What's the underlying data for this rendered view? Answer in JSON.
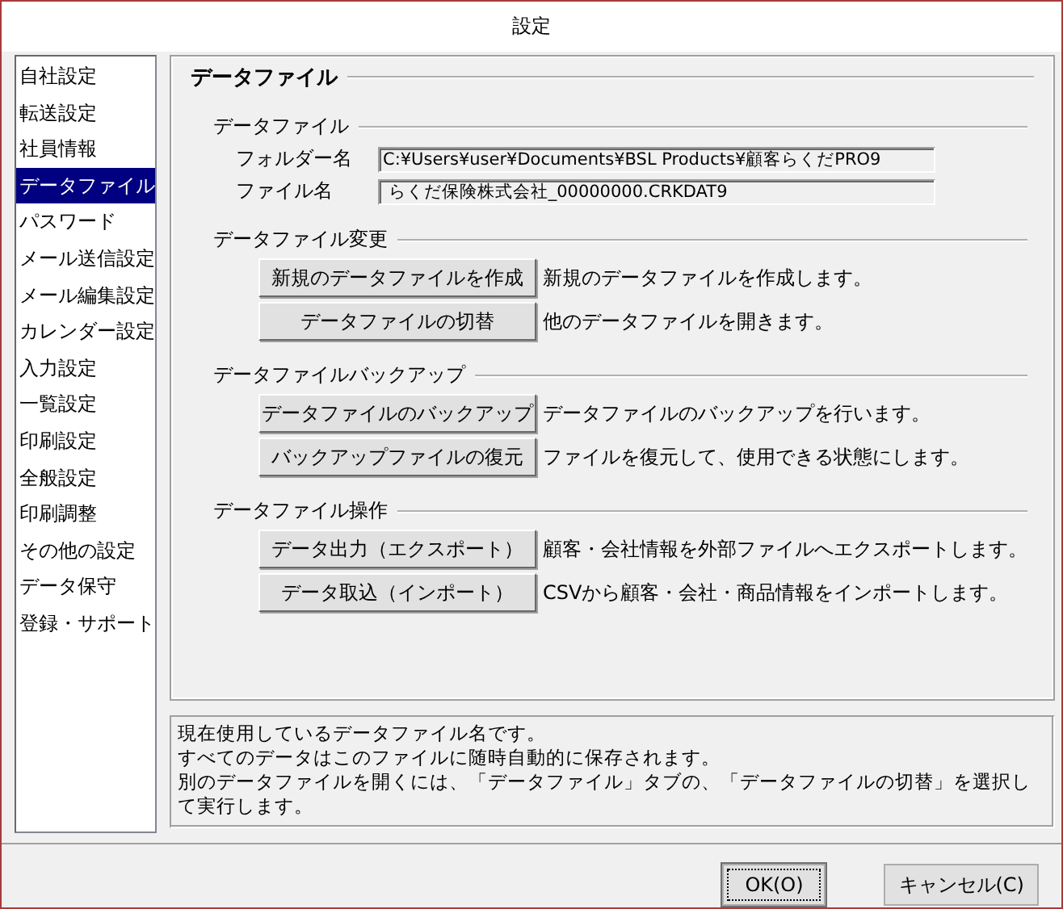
{
  "window": {
    "title": "設定"
  },
  "sidebar": {
    "items": [
      {
        "label": "自社設定",
        "selected": false
      },
      {
        "label": "転送設定",
        "selected": false
      },
      {
        "label": "社員情報",
        "selected": false
      },
      {
        "label": "データファイル",
        "selected": true
      },
      {
        "label": "パスワード",
        "selected": false
      },
      {
        "label": "メール送信設定",
        "selected": false
      },
      {
        "label": "メール編集設定",
        "selected": false
      },
      {
        "label": "カレンダー設定",
        "selected": false
      },
      {
        "label": "入力設定",
        "selected": false
      },
      {
        "label": "一覧設定",
        "selected": false
      },
      {
        "label": "印刷設定",
        "selected": false
      },
      {
        "label": "全般設定",
        "selected": false
      },
      {
        "label": "印刷調整",
        "selected": false
      },
      {
        "label": "その他の設定",
        "selected": false
      },
      {
        "label": "データ保守",
        "selected": false
      },
      {
        "label": "登録・サポート",
        "selected": false
      }
    ]
  },
  "panel": {
    "title": "データファイル",
    "sections": [
      {
        "title": "データファイル",
        "kind": "fields",
        "fields": [
          {
            "label": "フォルダー名",
            "value": "C:¥Users¥user¥Documents¥BSL Products¥顧客らくだPRO9"
          },
          {
            "label": "ファイル名",
            "value": " らくだ保険株式会社_00000000.CRKDAT9"
          }
        ]
      },
      {
        "title": "データファイル変更",
        "kind": "actions",
        "actions": [
          {
            "button": "新規のデータファイルを作成",
            "description": "新規のデータファイルを作成します。"
          },
          {
            "button": "データファイルの切替",
            "description": "他のデータファイルを開きます。"
          }
        ]
      },
      {
        "title": "データファイルバックアップ",
        "kind": "actions",
        "actions": [
          {
            "button": "データファイルのバックアップ",
            "description": "データファイルのバックアップを行います。"
          },
          {
            "button": "バックアップファイルの復元",
            "description": "ファイルを復元して、使用できる状態にします。"
          }
        ]
      },
      {
        "title": "データファイル操作",
        "kind": "actions",
        "actions": [
          {
            "button": "データ出力（エクスポート）",
            "description": "顧客・会社情報を外部ファイルへエクスポートします。"
          },
          {
            "button": "データ取込（インポート）",
            "description": "CSVから顧客・会社・商品情報をインポートします。"
          }
        ]
      }
    ]
  },
  "help_lines": [
    "現在使用しているデータファイル名です。",
    "すべてのデータはこのファイルに随時自動的に保存されます。",
    "別のデータファイルを開くには、「データファイル」タブの、「データファイルの切替」を選択して実行します。"
  ],
  "buttons": [
    {
      "label": "OK(O)",
      "default": true
    },
    {
      "label": "キャンセル(C)",
      "default": false
    }
  ]
}
